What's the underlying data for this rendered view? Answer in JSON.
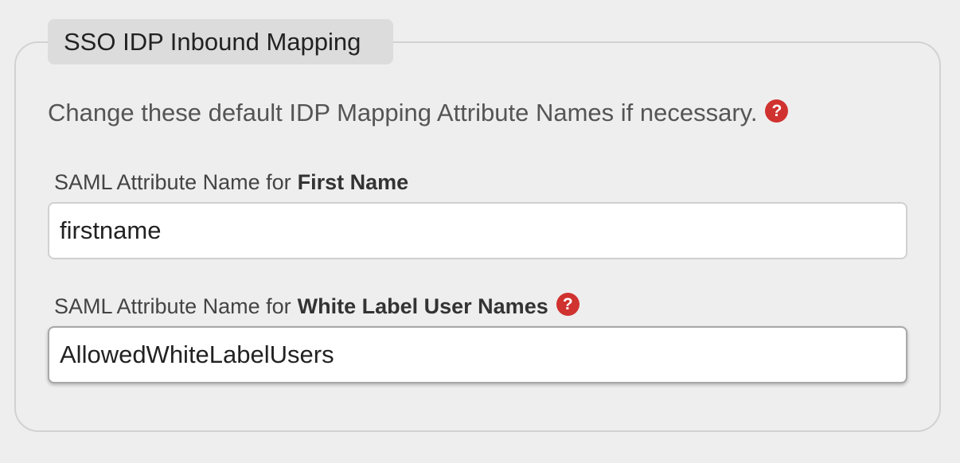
{
  "section": {
    "legend": "SSO IDP Inbound Mapping",
    "intro": "Change these default IDP Mapping Attribute Names if necessary.",
    "help_glyph": "?",
    "colors": {
      "help_icon": "#d0322f"
    }
  },
  "fields": [
    {
      "label_prefix": "SAML Attribute Name for",
      "label_bold": "First Name",
      "value": "firstname",
      "has_help": false
    },
    {
      "label_prefix": "SAML Attribute Name for",
      "label_bold": "White Label User Names",
      "value": "AllowedWhiteLabelUsers",
      "has_help": true
    }
  ]
}
